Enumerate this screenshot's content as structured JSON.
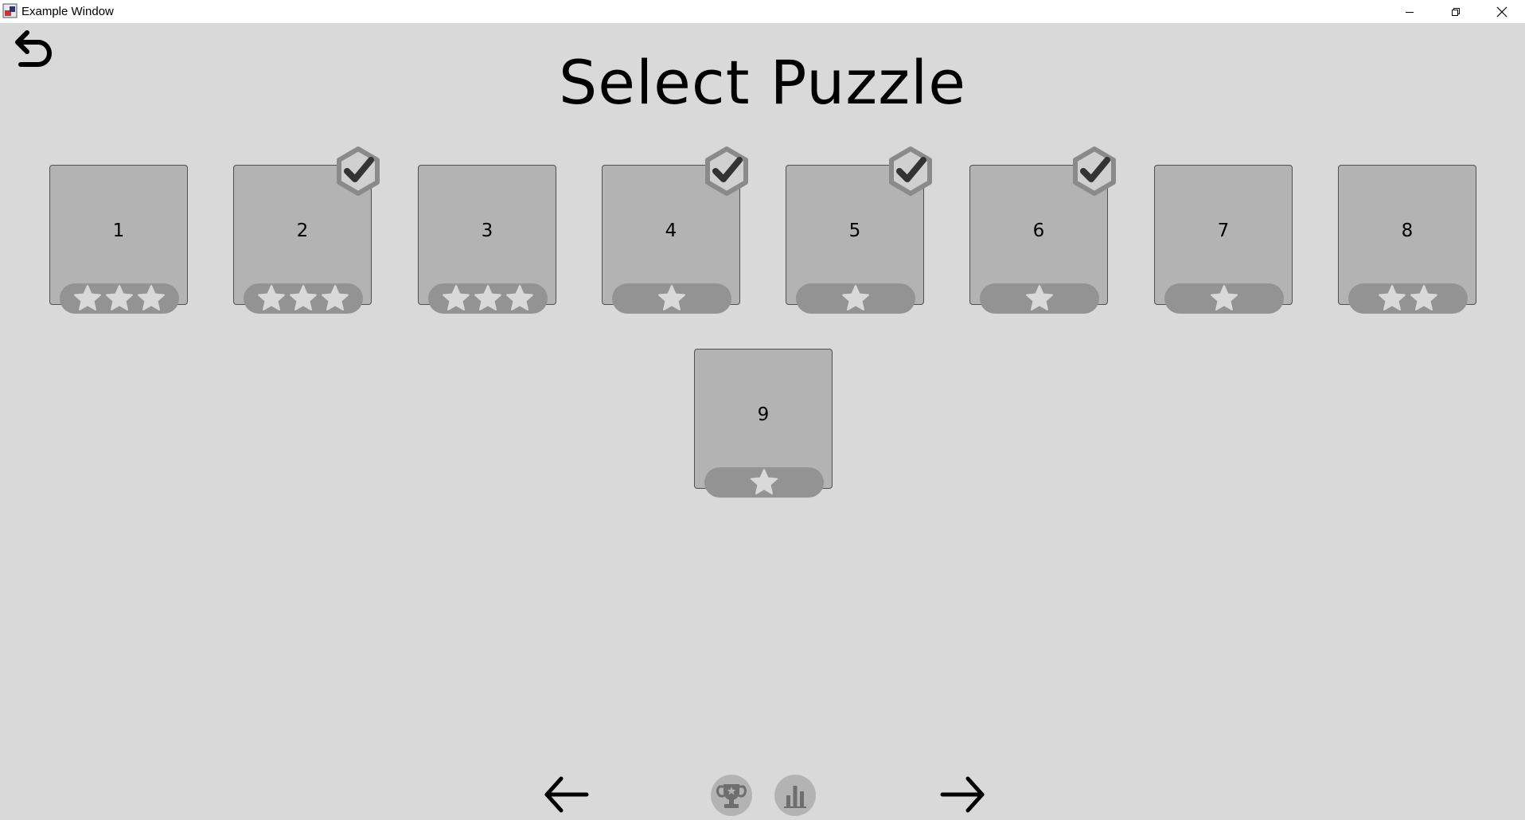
{
  "window": {
    "title": "Example Window"
  },
  "page": {
    "title": "Select Puzzle"
  },
  "colors": {
    "background": "#d9d9d9",
    "tile": "#b3b3b3",
    "star_bar": "#939393",
    "star": "#d9d9d9",
    "check": "#333333"
  },
  "icons": {
    "back": "undo-arrow-icon",
    "prev": "arrow-left-icon",
    "next": "arrow-right-icon",
    "trophy": "trophy-icon",
    "stats": "bar-chart-icon",
    "completed": "check-badge-icon"
  },
  "puzzles": [
    {
      "label": "1",
      "stars": 3,
      "completed": false
    },
    {
      "label": "2",
      "stars": 3,
      "completed": true
    },
    {
      "label": "3",
      "stars": 3,
      "completed": false
    },
    {
      "label": "4",
      "stars": 1,
      "completed": true
    },
    {
      "label": "5",
      "stars": 1,
      "completed": true
    },
    {
      "label": "6",
      "stars": 1,
      "completed": true
    },
    {
      "label": "7",
      "stars": 1,
      "completed": false
    },
    {
      "label": "8",
      "stars": 2,
      "completed": false
    },
    {
      "label": "9",
      "stars": 1,
      "completed": false
    }
  ]
}
